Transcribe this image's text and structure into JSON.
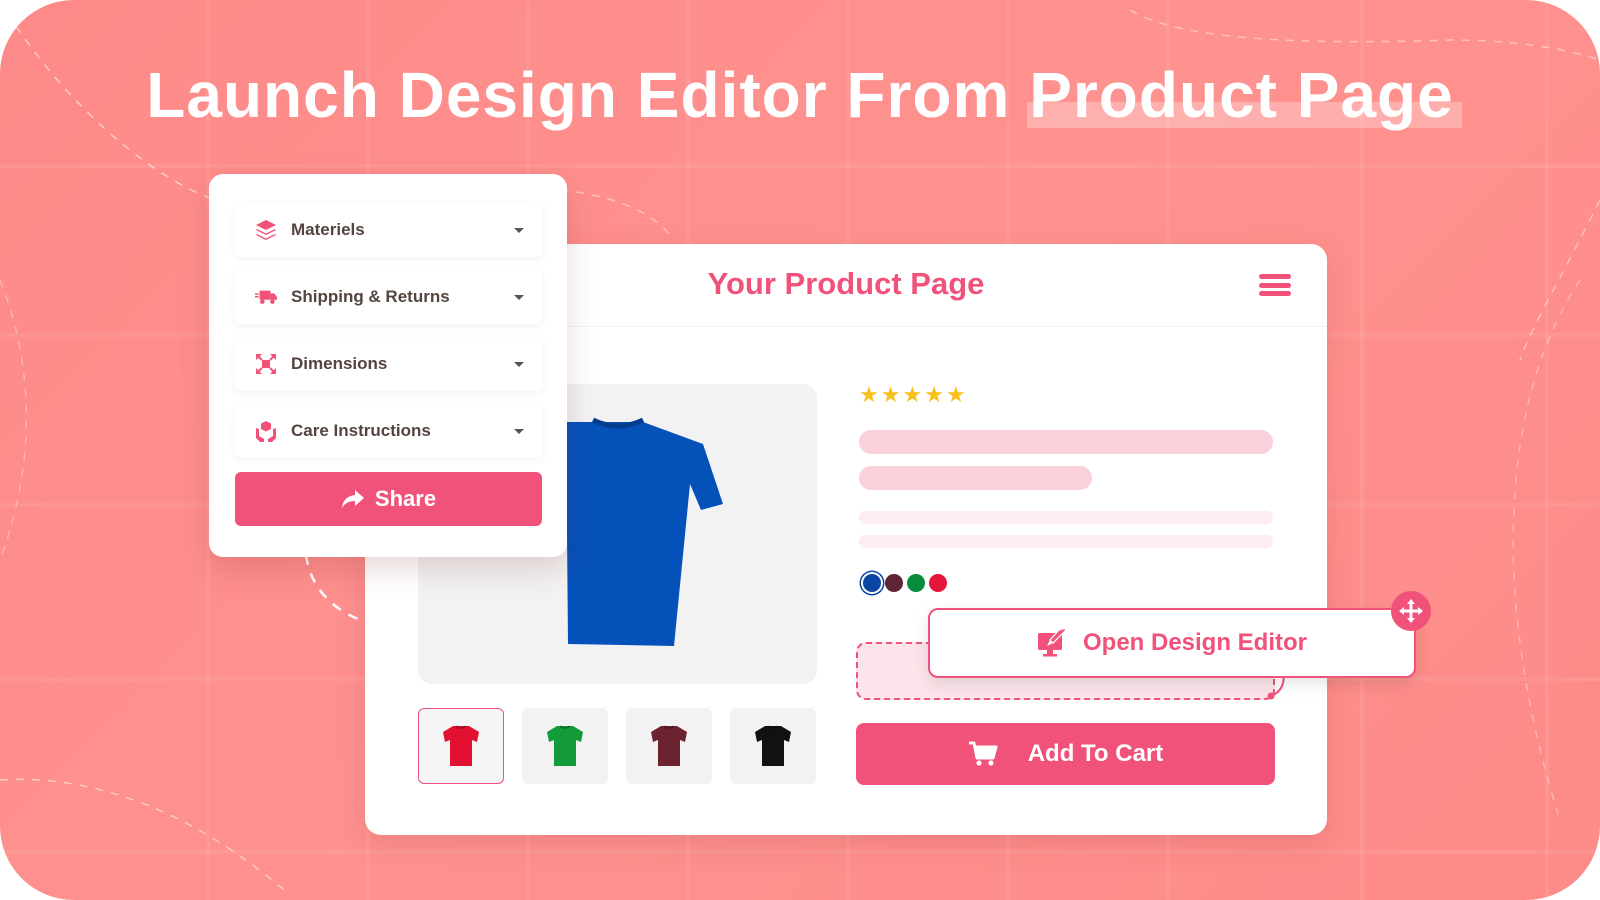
{
  "headline": {
    "text_plain": "Launch Design Editor From ",
    "text_highlight": "Product Page"
  },
  "accordion_panel": {
    "items": [
      {
        "label": "Materiels",
        "icon": "layers-icon"
      },
      {
        "label": "Shipping & Returns",
        "icon": "truck-icon"
      },
      {
        "label": "Dimensions",
        "icon": "expand-icon"
      },
      {
        "label": "Care Instructions",
        "icon": "hands-box-icon"
      }
    ],
    "share_label": "Share",
    "share_icon": "share-arrow-icon"
  },
  "product_page": {
    "title": "Your Product Page",
    "menu_icon": "hamburger-icon",
    "rating": {
      "value": 5,
      "max": 5
    },
    "main_image_color": "#0451b9",
    "thumbnails": [
      {
        "color": "#e31131",
        "selected": true
      },
      {
        "color": "#139b3a",
        "selected": false
      },
      {
        "color": "#6b2330",
        "selected": false
      },
      {
        "color": "#111111",
        "selected": false
      }
    ],
    "swatches": [
      {
        "color": "#0b45a3",
        "selected": true
      },
      {
        "color": "#5e2433",
        "selected": false
      },
      {
        "color": "#078c3b",
        "selected": false
      },
      {
        "color": "#e3153a",
        "selected": false
      }
    ],
    "add_to_cart_label": "Add To Cart",
    "cart_icon": "cart-icon"
  },
  "design_editor_button": {
    "label": "Open Design Editor",
    "icon": "monitor-brush-icon",
    "handle_icon": "move-icon"
  },
  "colors": {
    "accent": "#f0527a",
    "background": "#fe8f8c",
    "star": "#f9c11c",
    "skeleton_strong": "#fad1db",
    "skeleton_light": "#fdecf0"
  }
}
